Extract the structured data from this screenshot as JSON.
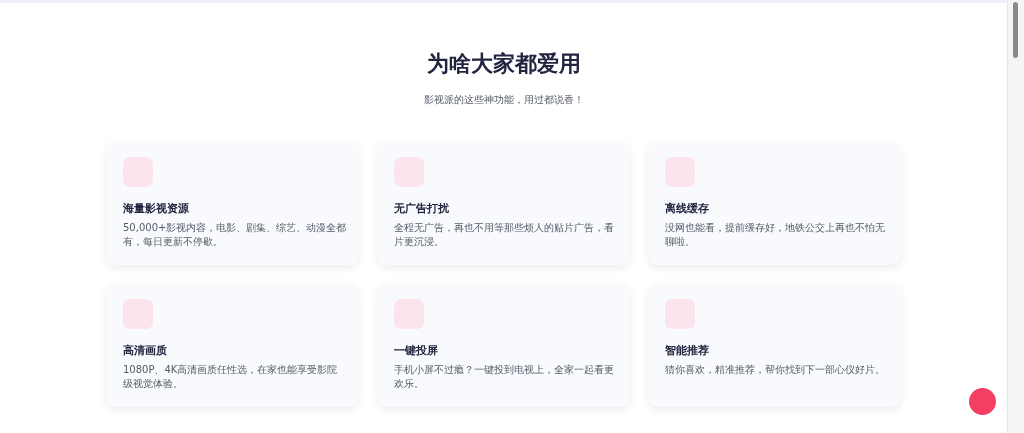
{
  "section": {
    "title": "为啥大家都爱用",
    "subtitle": "影视派的这些神功能，用过都说香！"
  },
  "features": [
    {
      "title": "海量影视资源",
      "description": "50,000+影视内容，电影、剧集、综艺、动漫全都有，每日更新不停歇。"
    },
    {
      "title": "无广告打扰",
      "description": "全程无广告，再也不用等那些烦人的贴片广告，看片更沉浸。"
    },
    {
      "title": "离线缓存",
      "description": "没网也能看，提前缓存好，地铁公交上再也不怕无聊啦。"
    },
    {
      "title": "高清画质",
      "description": "1080P、4K高清画质任性选，在家也能享受影院级视觉体验。"
    },
    {
      "title": "一键投屏",
      "description": "手机小屏不过瘾？一键投到电视上，全家一起看更欢乐。"
    },
    {
      "title": "智能推荐",
      "description": "猜你喜欢，精准推荐，帮你找到下一部心仪好片。"
    }
  ]
}
